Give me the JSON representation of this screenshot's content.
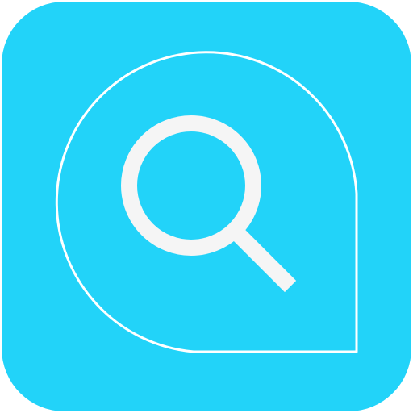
{
  "icon": {
    "name": "search-app-icon",
    "symbol": "magnifying-glass-icon",
    "shape": "rounded-square",
    "colors": {
      "background": "#22d3f9",
      "stroke": "#f5f5f5",
      "outline": "#ffffff"
    }
  }
}
